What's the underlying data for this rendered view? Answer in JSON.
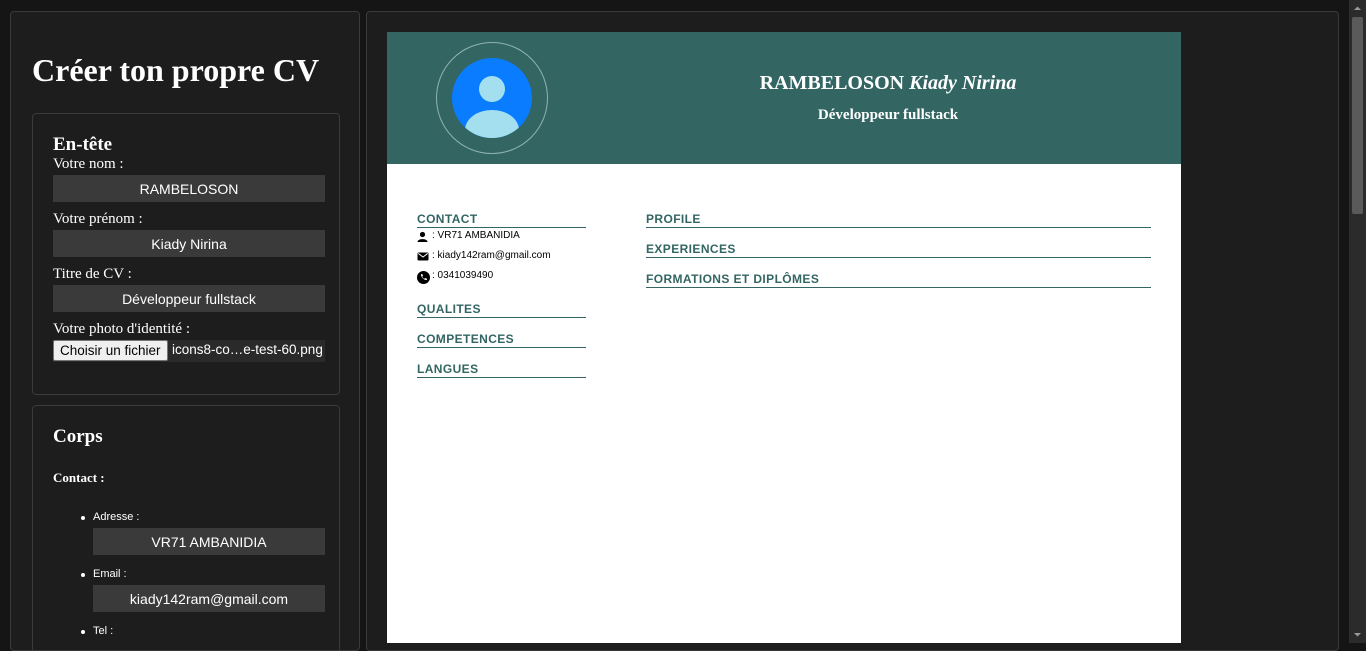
{
  "app": {
    "title": "Créer ton propre CV"
  },
  "header_section": {
    "title": "En-tête",
    "nom_label": "Votre nom :",
    "nom_value": "RAMBELOSON",
    "prenom_label": "Votre prénom :",
    "prenom_value": "Kiady Nirina",
    "titre_label": "Titre de CV :",
    "titre_value": "Développeur fullstack",
    "photo_label": "Votre photo d'identité :",
    "photo_button": "Choisir un fichier",
    "photo_filename": "icons8-co…e-test-60.png"
  },
  "body_section": {
    "title": "Corps",
    "contact_heading": "Contact :",
    "adresse_label": "Adresse :",
    "adresse_value": "VR71 AMBANIDIA",
    "email_label": "Email :",
    "email_value": "kiady142ram@gmail.com",
    "tel_label": "Tel :"
  },
  "cv": {
    "last_name": "RAMBELOSON",
    "first_name": "Kiady Nirina",
    "job_title": "Développeur fullstack",
    "left_sections": [
      "CONTACT",
      "QUALITES",
      "COMPETENCES",
      "LANGUES"
    ],
    "right_sections": [
      "PROFILE",
      "EXPERIENCES",
      "FORMATIONS ET DIPLÔMES"
    ],
    "contact": {
      "address": ": VR71 AMBANIDIA",
      "email": ": kiady142ram@gmail.com",
      "phone": ": 0341039490"
    }
  },
  "colors": {
    "cv_accent": "#336663",
    "photo_blue": "#0a7cff",
    "photo_light": "#a4dff0"
  },
  "icons": [
    "person-icon",
    "envelope-icon",
    "phone-icon",
    "avatar-icon"
  ]
}
